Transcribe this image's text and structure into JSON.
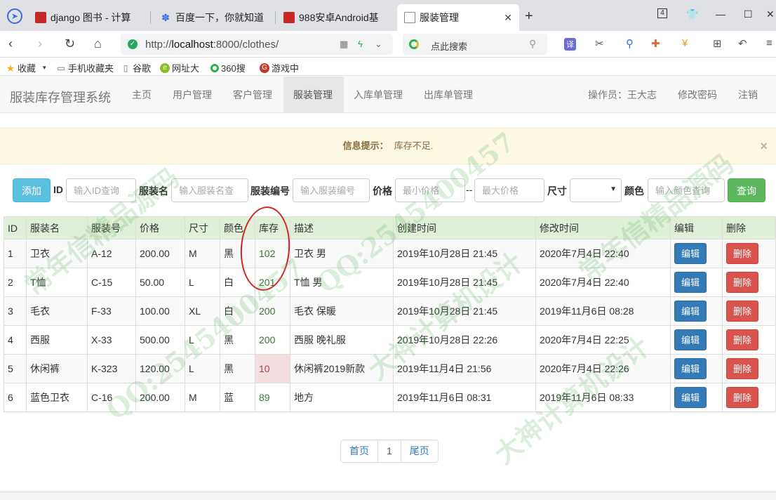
{
  "browser": {
    "tabs": [
      {
        "title": "django 图书 - 计算",
        "favicon": "red-square",
        "active": false
      },
      {
        "title": "百度一下，你就知道",
        "favicon": "paw",
        "active": false
      },
      {
        "title": "988安卓Android基",
        "favicon": "red-square",
        "active": false
      },
      {
        "title": "服装管理",
        "favicon": "doc",
        "active": true
      }
    ],
    "new_tab_label": "+",
    "tab_count": "4",
    "url_prefix": "http://",
    "url_host": "localhost",
    "url_rest": ":8000/clothes/",
    "search_placeholder": "点此搜索",
    "translate_label": "译",
    "bookmarks": [
      "收藏",
      "手机收藏夹",
      "谷歌",
      "网址大",
      "360搜",
      "游戏中"
    ]
  },
  "navbar": {
    "brand": "服装库存管理系统",
    "items": [
      "主页",
      "用户管理",
      "客户管理",
      "服装管理",
      "入库单管理",
      "出库单管理"
    ],
    "active_index": 3,
    "operator_label": "操作员：王大志",
    "change_password": "修改密码",
    "logout": "注销"
  },
  "alert": {
    "label": "信息提示：",
    "message": "库存不足.",
    "close": "×"
  },
  "search": {
    "add_label": "添加",
    "id_label": "ID",
    "id_placeholder": "输入ID查询",
    "name_label": "服装名",
    "name_placeholder": "输入服装名查",
    "code_label": "服装编号",
    "code_placeholder": "输入服装编号",
    "price_label": "价格",
    "min_price_placeholder": "最小价格",
    "range_sep": "--",
    "max_price_placeholder": "最大价格",
    "size_label": "尺寸",
    "size_value": "",
    "color_label": "颜色",
    "color_placeholder": "输入颜色查询",
    "query_label": "查询"
  },
  "table": {
    "headers": [
      "ID",
      "服装名",
      "服装号",
      "价格",
      "尺寸",
      "颜色",
      "库存",
      "描述",
      "创建时间",
      "修改时间",
      "编辑",
      "删除"
    ],
    "rows": [
      {
        "id": "1",
        "name": "卫衣",
        "code": "A-12",
        "price": "200.00",
        "size": "M",
        "color": "黑",
        "stock": "102",
        "desc": "卫衣 男",
        "created": "2019年10月28日 21:45",
        "modified": "2020年7月4日 22:40",
        "low": false
      },
      {
        "id": "2",
        "name": "T恤",
        "code": "C-15",
        "price": "50.00",
        "size": "L",
        "color": "白",
        "stock": "201",
        "desc": "T恤 男",
        "created": "2019年10月28日 21:45",
        "modified": "2020年7月4日 22:40",
        "low": false
      },
      {
        "id": "3",
        "name": "毛衣",
        "code": "F-33",
        "price": "100.00",
        "size": "XL",
        "color": "白",
        "stock": "200",
        "desc": "毛衣 保暖",
        "created": "2019年10月28日 21:45",
        "modified": "2019年11月6日 08:28",
        "low": false
      },
      {
        "id": "4",
        "name": "西服",
        "code": "X-33",
        "price": "500.00",
        "size": "L",
        "color": "黑",
        "stock": "200",
        "desc": "西服 晚礼服",
        "created": "2019年10月28日 22:26",
        "modified": "2020年7月4日 22:25",
        "low": false
      },
      {
        "id": "5",
        "name": "休闲裤",
        "code": "K-323",
        "price": "120.00",
        "size": "L",
        "color": "黑",
        "stock": "10",
        "desc": "休闲裤2019新款",
        "created": "2019年11月4日 21:56",
        "modified": "2020年7月4日 22:26",
        "low": true
      },
      {
        "id": "6",
        "name": "蓝色卫衣",
        "code": "C-16",
        "price": "200.00",
        "size": "M",
        "color": "蓝",
        "stock": "89",
        "desc": "地方",
        "created": "2019年11月6日 08:31",
        "modified": "2019年11月6日 08:33",
        "low": false
      }
    ],
    "edit_label": "编辑",
    "delete_label": "删除"
  },
  "pagination": {
    "first": "首页",
    "current": "1",
    "last": "尾页"
  },
  "watermark": [
    "常年信精品源码",
    "QQ:2545400457",
    "大神计算机设计"
  ],
  "colors": {
    "add_button": "#5bc0de",
    "query_button": "#5cb85c",
    "edit_button": "#337ab7",
    "delete_button": "#d9534f",
    "table_header": "#e0f0d8",
    "low_stock": "#f2dede"
  }
}
